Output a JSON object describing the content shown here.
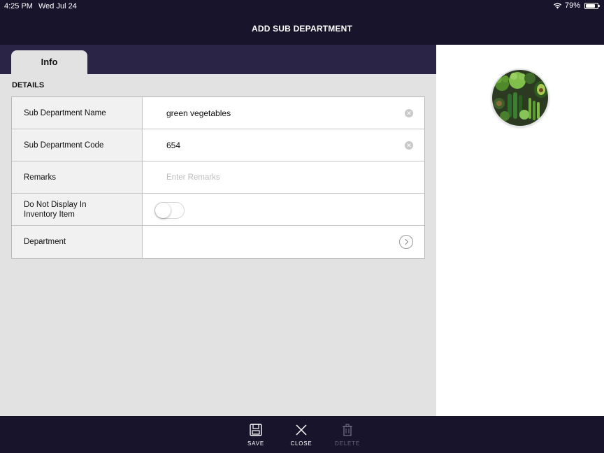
{
  "status_bar": {
    "time": "4:25 PM",
    "date": "Wed Jul 24",
    "battery_percent": "79%",
    "battery_level": 0.79,
    "wifi_icon": "wifi-icon"
  },
  "header": {
    "title": "ADD SUB DEPARTMENT"
  },
  "tabs": [
    {
      "label": "Info",
      "selected": true
    }
  ],
  "section": {
    "title": "DETAILS"
  },
  "form": {
    "sub_department_name": {
      "label": "Sub Department Name",
      "value": "green vegetables"
    },
    "sub_department_code": {
      "label": "Sub Department Code",
      "value": "654"
    },
    "remarks": {
      "label": "Remarks",
      "value": "",
      "placeholder": "Enter Remarks"
    },
    "do_not_display": {
      "label_line1": "Do Not Display In",
      "label_line2": "Inventory Item",
      "enabled": false
    },
    "department": {
      "label": "Department",
      "value": ""
    }
  },
  "image": {
    "icon": "green-vegetables-photo"
  },
  "toolbar": {
    "save": {
      "label": "SAVE",
      "icon": "save-icon"
    },
    "close": {
      "label": "CLOSE",
      "icon": "close-icon"
    },
    "delete": {
      "label": "DELETE",
      "icon": "trash-icon",
      "disabled": true
    }
  },
  "colors": {
    "header_bg": "#17142b",
    "tab_strip_bg": "#2a2547",
    "panel_bg": "#e2e2e2",
    "disabled_text": "#6a6780"
  }
}
